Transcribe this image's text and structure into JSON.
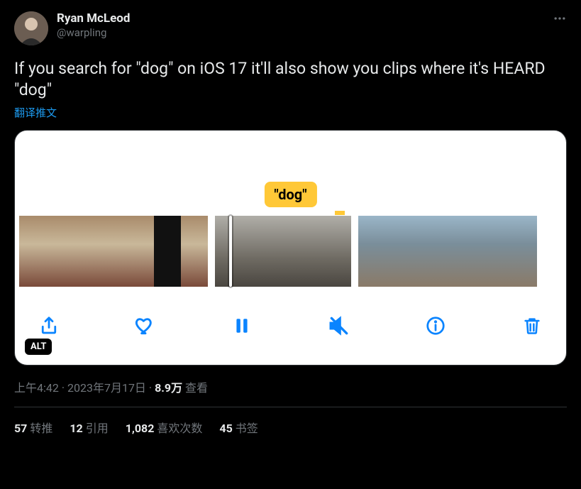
{
  "author": {
    "display_name": "Ryan McLeod",
    "handle": "@warpling"
  },
  "tweet_text": "If you search for \"dog\" on iOS 17 it'll also show you clips where it's HEARD \"dog\"",
  "translate_label": "翻译推文",
  "media": {
    "search_pill": "\"dog\"",
    "alt_badge": "ALT",
    "toolbar_icons": [
      "share-icon",
      "heart-icon",
      "pause-icon",
      "mute-icon",
      "info-icon",
      "trash-icon"
    ]
  },
  "meta": {
    "time": "上午4:42",
    "sep1": " · ",
    "date": "2023年7月17日",
    "sep2": " · ",
    "views_number": "8.9万",
    "views_label": " 查看"
  },
  "stats": {
    "retweets_num": "57",
    "retweets_label": "转推",
    "quotes_num": "12",
    "quotes_label": "引用",
    "likes_num": "1,082",
    "likes_label": "喜欢次数",
    "bookmarks_num": "45",
    "bookmarks_label": "书签"
  }
}
